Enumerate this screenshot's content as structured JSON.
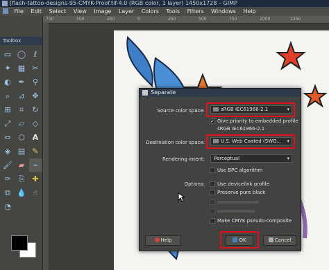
{
  "window": {
    "title": "[flash-tattoo-designs-95-CMYK-Proof.tif-4.0 (RGB color, 1 layer) 1450x1728 – GIMP"
  },
  "menubar": {
    "items": [
      "File",
      "Edit",
      "Select",
      "View",
      "Image",
      "Layer",
      "Colors",
      "Tools",
      "Filters",
      "Windows",
      "Help"
    ]
  },
  "ruler": {
    "ticks": [
      "750",
      "500",
      "250",
      "0",
      "250",
      "500",
      "750",
      "1000",
      "1250"
    ]
  },
  "toolbox": {
    "title": "Toolbox",
    "tools": [
      "rect-select-icon",
      "ellipse-select-icon",
      "lasso-icon",
      "fuzzy-select-icon",
      "color-select-icon",
      "scissors-icon",
      "foreground-select-icon",
      "paths-icon",
      "color-picker-icon",
      "zoom-icon",
      "measure-icon",
      "move-icon",
      "align-icon",
      "crop-icon",
      "rotate-icon",
      "scale-icon",
      "shear-icon",
      "perspective-icon",
      "flip-icon",
      "cage-icon",
      "text-icon",
      "bucket-fill-icon",
      "blend-icon",
      "pencil-icon",
      "paintbrush-icon",
      "eraser-icon",
      "airbrush-icon",
      "ink-icon",
      "clone-icon",
      "heal-icon",
      "perspective-clone-icon",
      "blur-icon",
      "smudge-icon",
      "dodge-icon"
    ]
  },
  "dialog": {
    "title": "Separate",
    "source_label": "Source color space:",
    "source_value": "sRGB IEC61966-2.1",
    "give_priority": "Give priority to embedded profile",
    "embedded_profile": "sRGB IEC61966-2.1",
    "destination_label": "Destination color space:",
    "destination_value": "U.S. Web Coated (SWO...",
    "rendering_label": "Rendering intent:",
    "rendering_value": "Perceptual",
    "use_bpc": "Use BPC algorithm",
    "options_label": "Options:",
    "use_devicelink": "Use devicelink profile",
    "preserve_black": "Preserve pure black",
    "make_cmyk": "Make CMYK pseudo-composite",
    "help_label": "Help",
    "ok_label": "OK",
    "cancel_label": "Cancel"
  },
  "colors": {
    "highlight": "#e0101c",
    "titlebar": "#2e3a4c"
  }
}
